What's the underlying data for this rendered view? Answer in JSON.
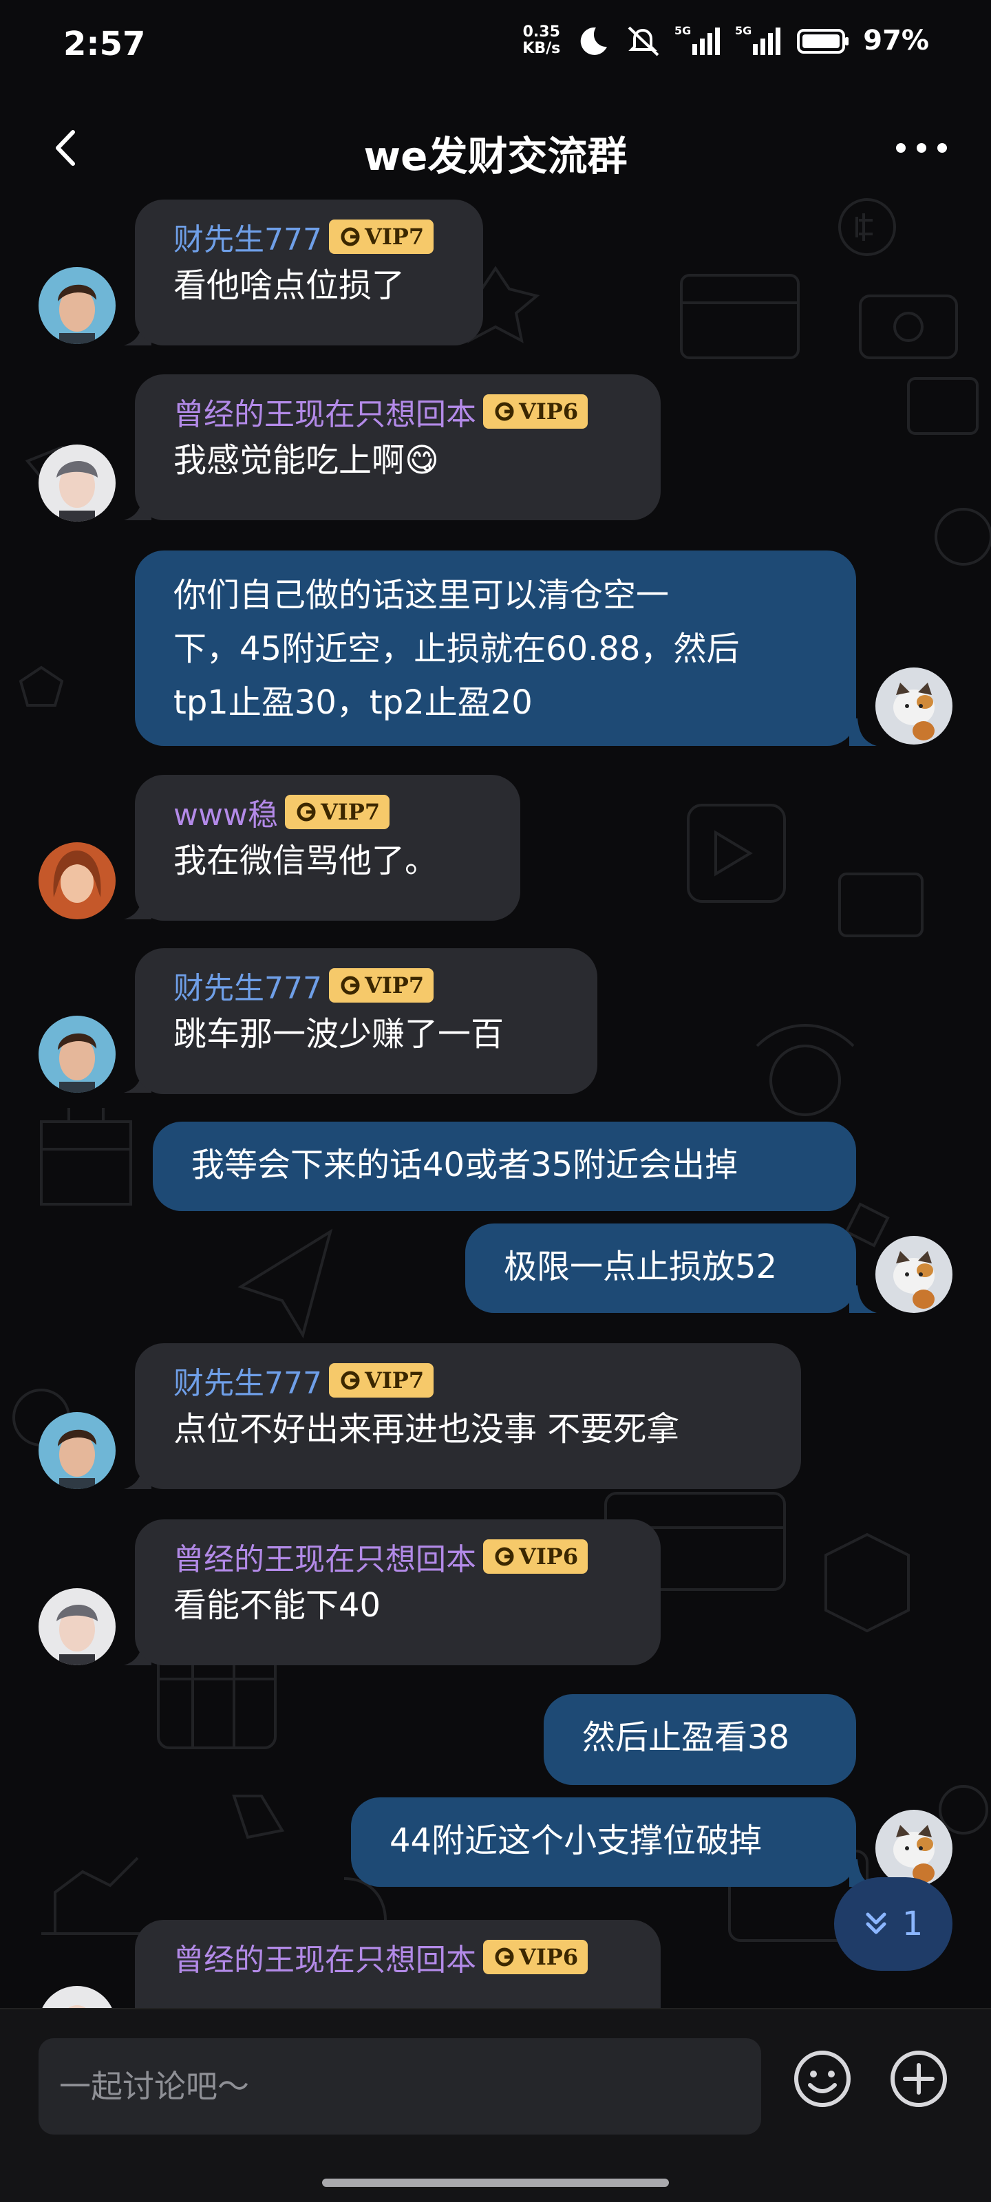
{
  "status_bar": {
    "time": "2:57",
    "net_speed_value": "0.35",
    "net_speed_unit": "KB/s",
    "signal1": "5G",
    "signal2": "5G",
    "battery": "97%"
  },
  "header": {
    "title": "we发财交流群"
  },
  "messages": [
    {
      "sender": "财先生777",
      "vip": "VIP7",
      "text": "看他啥点位损了"
    },
    {
      "sender": "曾经的王现在只想回本",
      "vip": "VIP6",
      "text": "我感觉能吃上啊😋"
    },
    {
      "text": "你们自己做的话这里可以清仓空一\n下，45附近空，止损就在60.88，然后\ntp1止盈30，tp2止盈20"
    },
    {
      "sender": "www稳",
      "vip": "VIP7",
      "text": "我在微信骂他了。"
    },
    {
      "sender": "财先生777",
      "vip": "VIP7",
      "text": "跳车那一波少赚了一百"
    },
    {
      "text": "我等会下来的话40或者35附近会出掉"
    },
    {
      "text": "极限一点止损放52"
    },
    {
      "sender": "财先生777",
      "vip": "VIP7",
      "text": "点位不好出来再进也没事 不要死拿"
    },
    {
      "sender": "曾经的王现在只想回本",
      "vip": "VIP6",
      "text": "看能不能下40"
    },
    {
      "text": "然后止盈看38"
    },
    {
      "text": "44附近这个小支撑位破掉"
    },
    {
      "sender": "曾经的王现在只想回本",
      "vip": "VIP6",
      "text": ""
    }
  ],
  "unread": {
    "count": "1"
  },
  "input": {
    "placeholder": "一起讨论吧～"
  },
  "colors": {
    "background": "#0b0b0d",
    "incoming_bubble": "#2a2b30",
    "outgoing_bubble": "#1e4a75",
    "vip_badge": "#f6c96a",
    "sender_blue": "#6f9fe8",
    "sender_purple": "#b38ae8"
  },
  "icons": [
    "back-arrow-icon",
    "more-dots-icon",
    "moon-icon",
    "mute-icon",
    "signal-icon",
    "battery-icon",
    "vip-crown-icon",
    "double-chevron-down-icon",
    "emoji-icon",
    "plus-circle-icon"
  ]
}
